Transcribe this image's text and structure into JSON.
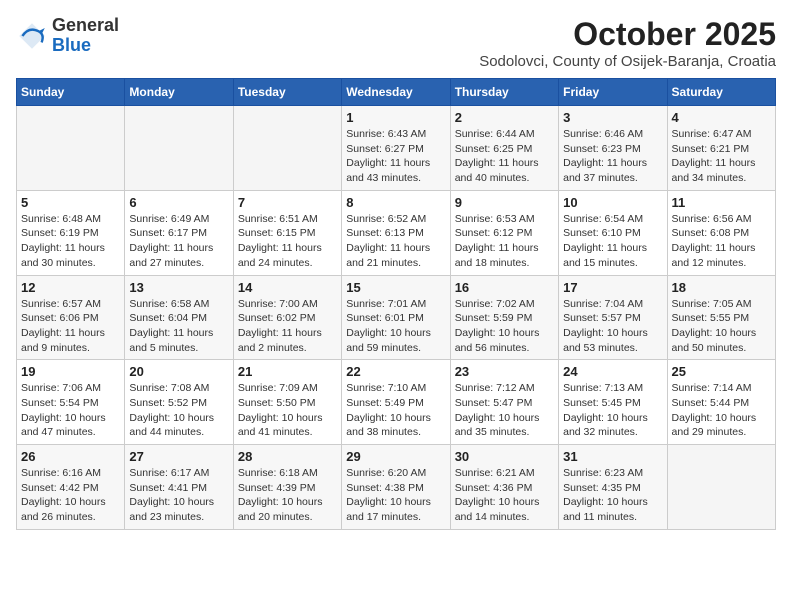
{
  "header": {
    "logo_general": "General",
    "logo_blue": "Blue",
    "month": "October 2025",
    "subtitle": "Sodolovci, County of Osijek-Baranja, Croatia"
  },
  "weekdays": [
    "Sunday",
    "Monday",
    "Tuesday",
    "Wednesday",
    "Thursday",
    "Friday",
    "Saturday"
  ],
  "weeks": [
    [
      {
        "day": null
      },
      {
        "day": null
      },
      {
        "day": null
      },
      {
        "day": "1",
        "sunrise": "Sunrise: 6:43 AM",
        "sunset": "Sunset: 6:27 PM",
        "daylight": "Daylight: 11 hours and 43 minutes."
      },
      {
        "day": "2",
        "sunrise": "Sunrise: 6:44 AM",
        "sunset": "Sunset: 6:25 PM",
        "daylight": "Daylight: 11 hours and 40 minutes."
      },
      {
        "day": "3",
        "sunrise": "Sunrise: 6:46 AM",
        "sunset": "Sunset: 6:23 PM",
        "daylight": "Daylight: 11 hours and 37 minutes."
      },
      {
        "day": "4",
        "sunrise": "Sunrise: 6:47 AM",
        "sunset": "Sunset: 6:21 PM",
        "daylight": "Daylight: 11 hours and 34 minutes."
      }
    ],
    [
      {
        "day": "5",
        "sunrise": "Sunrise: 6:48 AM",
        "sunset": "Sunset: 6:19 PM",
        "daylight": "Daylight: 11 hours and 30 minutes."
      },
      {
        "day": "6",
        "sunrise": "Sunrise: 6:49 AM",
        "sunset": "Sunset: 6:17 PM",
        "daylight": "Daylight: 11 hours and 27 minutes."
      },
      {
        "day": "7",
        "sunrise": "Sunrise: 6:51 AM",
        "sunset": "Sunset: 6:15 PM",
        "daylight": "Daylight: 11 hours and 24 minutes."
      },
      {
        "day": "8",
        "sunrise": "Sunrise: 6:52 AM",
        "sunset": "Sunset: 6:13 PM",
        "daylight": "Daylight: 11 hours and 21 minutes."
      },
      {
        "day": "9",
        "sunrise": "Sunrise: 6:53 AM",
        "sunset": "Sunset: 6:12 PM",
        "daylight": "Daylight: 11 hours and 18 minutes."
      },
      {
        "day": "10",
        "sunrise": "Sunrise: 6:54 AM",
        "sunset": "Sunset: 6:10 PM",
        "daylight": "Daylight: 11 hours and 15 minutes."
      },
      {
        "day": "11",
        "sunrise": "Sunrise: 6:56 AM",
        "sunset": "Sunset: 6:08 PM",
        "daylight": "Daylight: 11 hours and 12 minutes."
      }
    ],
    [
      {
        "day": "12",
        "sunrise": "Sunrise: 6:57 AM",
        "sunset": "Sunset: 6:06 PM",
        "daylight": "Daylight: 11 hours and 9 minutes."
      },
      {
        "day": "13",
        "sunrise": "Sunrise: 6:58 AM",
        "sunset": "Sunset: 6:04 PM",
        "daylight": "Daylight: 11 hours and 5 minutes."
      },
      {
        "day": "14",
        "sunrise": "Sunrise: 7:00 AM",
        "sunset": "Sunset: 6:02 PM",
        "daylight": "Daylight: 11 hours and 2 minutes."
      },
      {
        "day": "15",
        "sunrise": "Sunrise: 7:01 AM",
        "sunset": "Sunset: 6:01 PM",
        "daylight": "Daylight: 10 hours and 59 minutes."
      },
      {
        "day": "16",
        "sunrise": "Sunrise: 7:02 AM",
        "sunset": "Sunset: 5:59 PM",
        "daylight": "Daylight: 10 hours and 56 minutes."
      },
      {
        "day": "17",
        "sunrise": "Sunrise: 7:04 AM",
        "sunset": "Sunset: 5:57 PM",
        "daylight": "Daylight: 10 hours and 53 minutes."
      },
      {
        "day": "18",
        "sunrise": "Sunrise: 7:05 AM",
        "sunset": "Sunset: 5:55 PM",
        "daylight": "Daylight: 10 hours and 50 minutes."
      }
    ],
    [
      {
        "day": "19",
        "sunrise": "Sunrise: 7:06 AM",
        "sunset": "Sunset: 5:54 PM",
        "daylight": "Daylight: 10 hours and 47 minutes."
      },
      {
        "day": "20",
        "sunrise": "Sunrise: 7:08 AM",
        "sunset": "Sunset: 5:52 PM",
        "daylight": "Daylight: 10 hours and 44 minutes."
      },
      {
        "day": "21",
        "sunrise": "Sunrise: 7:09 AM",
        "sunset": "Sunset: 5:50 PM",
        "daylight": "Daylight: 10 hours and 41 minutes."
      },
      {
        "day": "22",
        "sunrise": "Sunrise: 7:10 AM",
        "sunset": "Sunset: 5:49 PM",
        "daylight": "Daylight: 10 hours and 38 minutes."
      },
      {
        "day": "23",
        "sunrise": "Sunrise: 7:12 AM",
        "sunset": "Sunset: 5:47 PM",
        "daylight": "Daylight: 10 hours and 35 minutes."
      },
      {
        "day": "24",
        "sunrise": "Sunrise: 7:13 AM",
        "sunset": "Sunset: 5:45 PM",
        "daylight": "Daylight: 10 hours and 32 minutes."
      },
      {
        "day": "25",
        "sunrise": "Sunrise: 7:14 AM",
        "sunset": "Sunset: 5:44 PM",
        "daylight": "Daylight: 10 hours and 29 minutes."
      }
    ],
    [
      {
        "day": "26",
        "sunrise": "Sunrise: 6:16 AM",
        "sunset": "Sunset: 4:42 PM",
        "daylight": "Daylight: 10 hours and 26 minutes."
      },
      {
        "day": "27",
        "sunrise": "Sunrise: 6:17 AM",
        "sunset": "Sunset: 4:41 PM",
        "daylight": "Daylight: 10 hours and 23 minutes."
      },
      {
        "day": "28",
        "sunrise": "Sunrise: 6:18 AM",
        "sunset": "Sunset: 4:39 PM",
        "daylight": "Daylight: 10 hours and 20 minutes."
      },
      {
        "day": "29",
        "sunrise": "Sunrise: 6:20 AM",
        "sunset": "Sunset: 4:38 PM",
        "daylight": "Daylight: 10 hours and 17 minutes."
      },
      {
        "day": "30",
        "sunrise": "Sunrise: 6:21 AM",
        "sunset": "Sunset: 4:36 PM",
        "daylight": "Daylight: 10 hours and 14 minutes."
      },
      {
        "day": "31",
        "sunrise": "Sunrise: 6:23 AM",
        "sunset": "Sunset: 4:35 PM",
        "daylight": "Daylight: 10 hours and 11 minutes."
      },
      {
        "day": null
      }
    ]
  ]
}
